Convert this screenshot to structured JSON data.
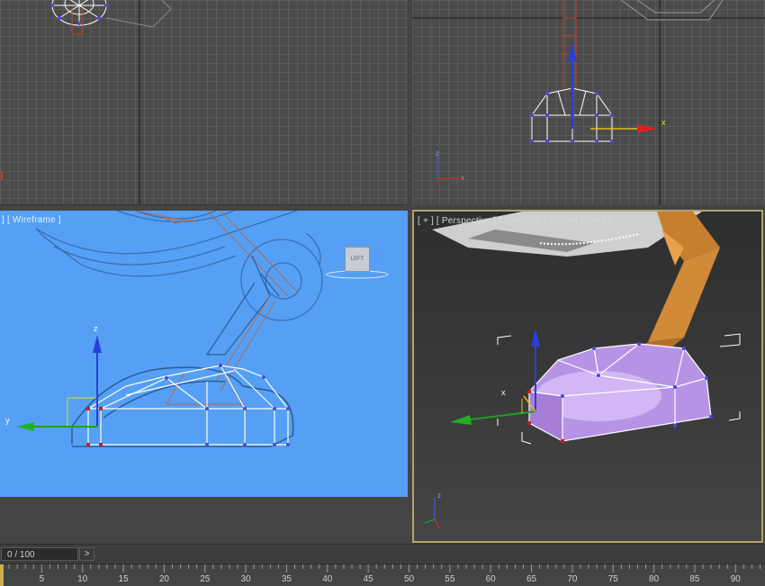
{
  "viewports": {
    "top": {
      "label": ""
    },
    "front": {
      "label": ""
    },
    "left": {
      "label": "] [ Wireframe ]",
      "viewcube": "LEFT"
    },
    "perspective": {
      "label": "[ + ] [ Perspective ] [ Realistic + Edged Faces ]"
    }
  },
  "axes": {
    "x": "x",
    "y": "y",
    "z": "z"
  },
  "timeline": {
    "frame_display": "0 / 100",
    "next_button": ">",
    "ruler_labels": [
      "5",
      "10",
      "15",
      "20",
      "25",
      "30",
      "35",
      "40",
      "45",
      "50",
      "55",
      "60",
      "65",
      "70",
      "75",
      "80",
      "85",
      "90"
    ],
    "ruler_values": [
      5,
      10,
      15,
      20,
      25,
      30,
      35,
      40,
      45,
      50,
      55,
      60,
      65,
      70,
      75,
      80,
      85,
      90
    ],
    "current_frame": 0
  },
  "colors": {
    "accent_active_viewport": "#b5a26a",
    "left_viewport_bg": "#55a0f5",
    "selection_purple": "#c9a2f2",
    "arm_orange": "#d08a38"
  }
}
